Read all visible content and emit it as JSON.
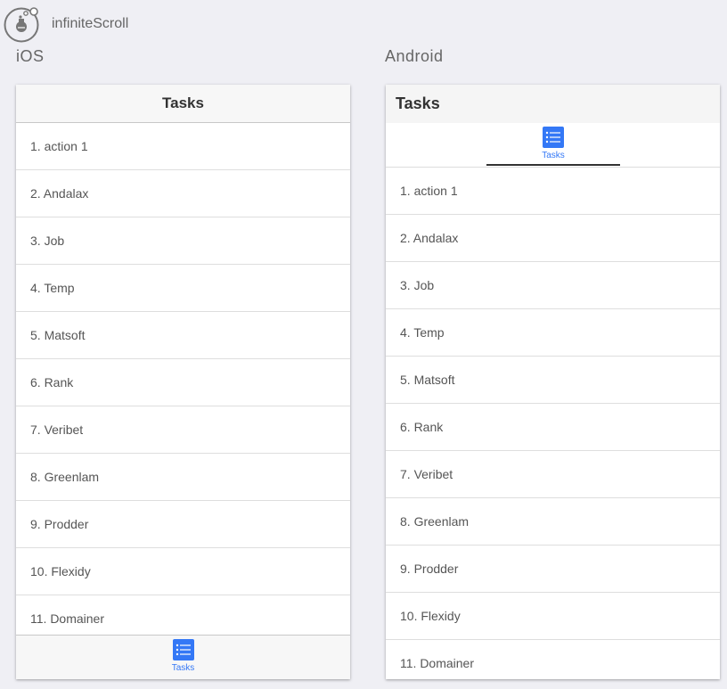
{
  "app": {
    "title": "infiniteScroll"
  },
  "ios": {
    "platform_label": "iOS",
    "nav_title": "Tasks",
    "tab_label": "Tasks",
    "items": [
      "1. action 1",
      "2. Andalax",
      "3. Job",
      "4. Temp",
      "5. Matsoft",
      "6. Rank",
      "7. Veribet",
      "8. Greenlam",
      "9. Prodder",
      "10. Flexidy",
      "11. Domainer"
    ]
  },
  "android": {
    "platform_label": "Android",
    "toolbar_title": "Tasks",
    "tab_label": "Tasks",
    "items": [
      "1. action 1",
      "2. Andalax",
      "3. Job",
      "4. Temp",
      "5. Matsoft",
      "6. Rank",
      "7. Veribet",
      "8. Greenlam",
      "9. Prodder",
      "10. Flexidy",
      "11. Domainer"
    ]
  },
  "icons": {
    "logo": "flask-bubbles-icon",
    "tab": "task-list-icon"
  },
  "colors": {
    "accent": "#3478f6",
    "background": "#efeff4",
    "tab_indicator": "#333333"
  }
}
